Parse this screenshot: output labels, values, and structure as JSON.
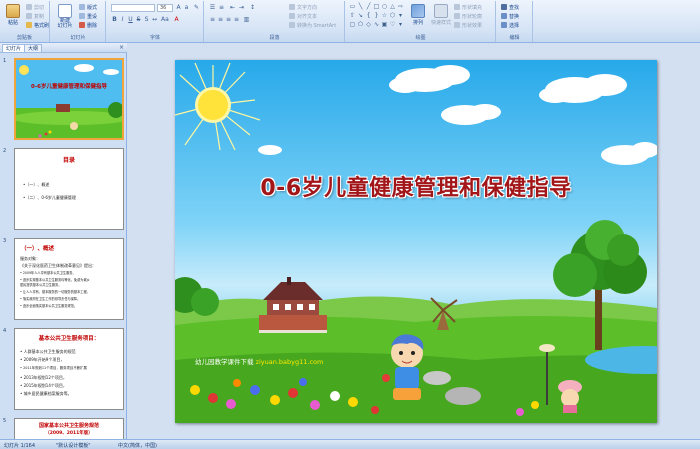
{
  "ribbon": {
    "clipboard": {
      "paste": "粘贴",
      "cut": "剪切",
      "copy": "复制",
      "format_painter": "格式刷",
      "label": "剪贴板"
    },
    "slides": {
      "new_slide": "新建\n幻灯片",
      "layout": "版式",
      "reset": "重设",
      "delete": "删除",
      "label": "幻灯片"
    },
    "font": {
      "font_size": "36",
      "label": "字体"
    },
    "paragraph": {
      "text_direction": "文字方向",
      "align_text": "对齐文本",
      "convert_smartart": "转换为 SmartArt",
      "label": "段落"
    },
    "drawing": {
      "arrange": "排列",
      "quick_styles": "快速样式",
      "shape_fill": "形状填充",
      "shape_outline": "形状轮廓",
      "shape_effects": "形状效果",
      "label": "绘图"
    },
    "editing": {
      "find": "查找",
      "replace": "替换",
      "select": "选择",
      "label": "编辑"
    }
  },
  "panel": {
    "tab_slides": "幻灯片",
    "tab_outline": "大纲",
    "close": "×",
    "thumbnails": [
      {
        "num": "1",
        "title": "0-6岁儿童健康管理和保健指导"
      },
      {
        "num": "2",
        "title": "目录",
        "lines": [
          "•（一）、概述",
          "•（二）、0-6岁儿童健康管理"
        ]
      },
      {
        "num": "3",
        "title": "（一）、概述",
        "lines": [
          "服务对象：",
          "《关于深化医药卫生体制改革意见》提出：",
          "• 2009年人人享有基本公共卫生服务。",
          "• 逐步实现基本公共卫生服务均等化，免费为城乡",
          "  居民提供基本公共卫生服务。",
          "• 让人人享有，基本服务的一切服务的基本工程。",
          "• 落实政府在卫生工作的领导责任与保障。",
          "• 逐步全面落实基本公共卫生服务规范。"
        ]
      },
      {
        "num": "4",
        "title": "基本公共卫生服务项目：",
        "lines": [
          "• 人群基本公共卫生服务的规范",
          "• 2009年开始9个项目，",
          "• 2011年规划11个项目，服务项目不断扩展",
          "• 2013年规划12个项目，",
          "• 2015年规划14个项目，",
          "• 城乡居民健康档案服务等。"
        ]
      },
      {
        "num": "5",
        "title": "国家基本公共卫生服务规范",
        "lines": [
          "（2009、2011年版）"
        ]
      }
    ]
  },
  "slide": {
    "title": "0-6岁儿童健康管理和保健指导",
    "website_prefix": "幼儿园教学课件下载",
    "website_url": "ziyuan.babyg11.com"
  },
  "status": {
    "slide_count": "幻灯片 1/164",
    "theme": "\"默认设计模板\"",
    "language": "中文(简体，中国)"
  },
  "colors": {
    "title_red": "#a2161a",
    "sky_blue": "#27a9ea",
    "grass_green": "#5cbf2a"
  }
}
